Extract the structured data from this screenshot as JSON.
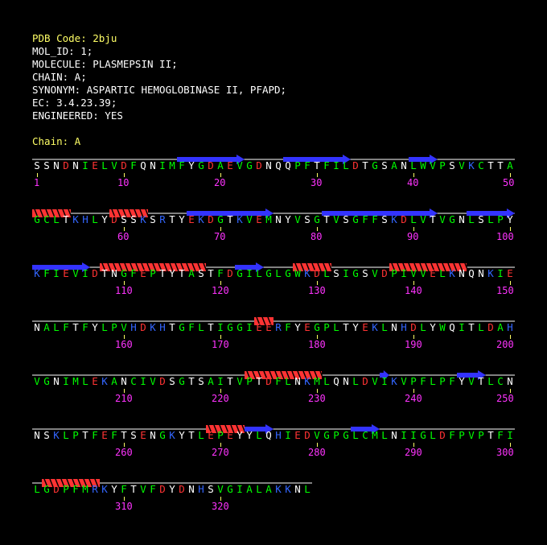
{
  "header": {
    "pdb_code": "PDB Code: 2bju",
    "lines": [
      "MOL_ID: 1;",
      "MOLECULE: PLASMEPSIN II;",
      "CHAIN: A;",
      "SYNONYM: ASPARTIC HEMOGLOBINASE II, PFAPD;",
      "EC: 3.4.23.39;",
      "ENGINEERED: YES"
    ],
    "chain_label": "Chain: A"
  },
  "colors": {
    "background": "#000000",
    "hydrophobic": "#00ff00",
    "polar": "#ffffff",
    "acidic": "#ff3333",
    "basic": "#3366ff",
    "helix": "#ff3333",
    "strand": "#3333ff",
    "number": "#ff33ff",
    "highlight": "#ffff66",
    "ruler": "#ffffff"
  },
  "rows": [
    {
      "sequence": "SSNDNIELVDFQNIMFYGDAEVGDNQQPFTFILDTGSANLWVPSVKCTTA",
      "numbers": [
        1,
        10,
        20,
        30,
        40,
        50
      ],
      "helices": [],
      "strands": [
        [
          15,
          22
        ],
        [
          26,
          33
        ],
        [
          39,
          42
        ]
      ]
    },
    {
      "sequence": "GCLTKHLYDSSKSRTYEKDGTKVEMNYVSGTVSGFFSKDLVTVGNLSLPY",
      "numbers": [
        60,
        70,
        80,
        90,
        100
      ],
      "helices": [
        [
          0,
          4
        ],
        [
          8,
          12
        ]
      ],
      "strands": [
        [
          16,
          25
        ],
        [
          30,
          42
        ],
        [
          45,
          50
        ]
      ]
    },
    {
      "sequence": "KFIEVIDTNGFEPTYTASTFDGILGLGWKDLSIGSVDPIVVELKNQNKIE",
      "numbers": [
        110,
        120,
        130,
        140,
        150
      ],
      "helices": [
        [
          7,
          18
        ],
        [
          27,
          31
        ],
        [
          37,
          45
        ]
      ],
      "strands": [
        [
          0,
          6
        ],
        [
          21,
          24
        ]
      ]
    },
    {
      "sequence": "NALFTFYLPVHDKHTGFLTIGGIEERFYEGPLTYEKLNHDLYWQITLDAH",
      "numbers": [
        160,
        170,
        180,
        190,
        200
      ],
      "helices": [
        [
          23,
          25
        ]
      ],
      "strands": []
    },
    {
      "sequence": "VGNIMLEKANCIVDSGTSAITVPTDFLNKMLQNLDVIKVPFLPFYVTLCN",
      "numbers": [
        210,
        220,
        230,
        240,
        250
      ],
      "helices": [
        [
          22,
          30
        ]
      ],
      "strands": [
        [
          36,
          37
        ],
        [
          44,
          47
        ]
      ]
    },
    {
      "sequence": "NSKLPTFEFTSENGKYTLEPEYYLQHIEDVGPGLCMLNIIGLDFPVPTFI",
      "numbers": [
        260,
        270,
        280,
        290,
        300
      ],
      "helices": [
        [
          18,
          22
        ]
      ],
      "strands": [
        [
          22,
          25
        ],
        [
          33,
          36
        ]
      ]
    },
    {
      "sequence": "LGDPFMRKYFTVFDYDNHSVGIALAKKNL",
      "numbers": [
        310,
        320
      ],
      "helices": [
        [
          1,
          7
        ]
      ],
      "strands": []
    }
  ]
}
